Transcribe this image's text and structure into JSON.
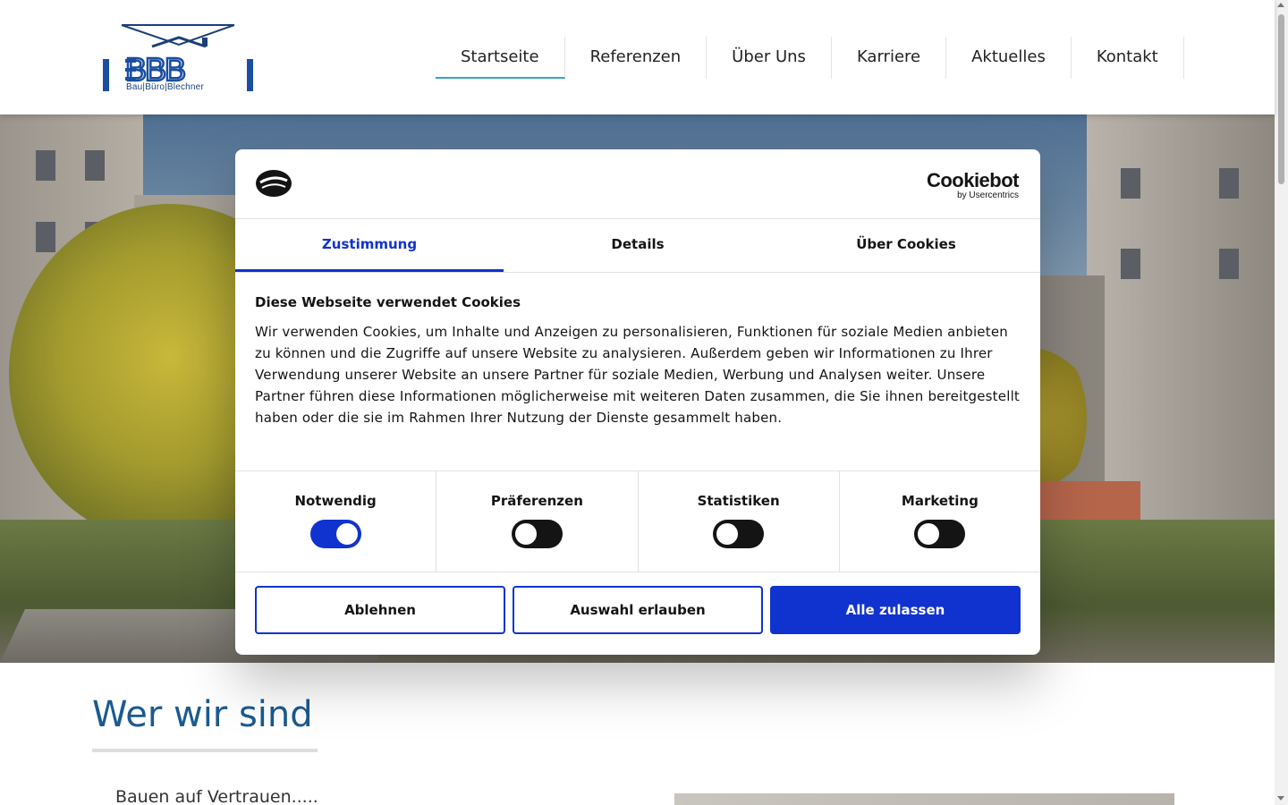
{
  "header": {
    "logo_text": "BBB",
    "logo_sub": "Bau|Büro|Blechner",
    "nav": [
      {
        "label": "Startseite",
        "active": true
      },
      {
        "label": "Referenzen"
      },
      {
        "label": "Über Uns"
      },
      {
        "label": "Karriere"
      },
      {
        "label": "Aktuelles"
      },
      {
        "label": "Kontakt"
      }
    ]
  },
  "main": {
    "section_title": "Wer wir sind",
    "intro": "Bauen auf Vertrauen....."
  },
  "cookie_dialog": {
    "brand": "Cookiebot",
    "brand_sub": "by Usercentrics",
    "tabs": [
      {
        "label": "Zustimmung",
        "active": true
      },
      {
        "label": "Details"
      },
      {
        "label": "Über Cookies"
      }
    ],
    "title": "Diese Webseite verwendet Cookies",
    "text": "Wir verwenden Cookies, um Inhalte und Anzeigen zu personalisieren, Funktionen für soziale Medien anbieten zu können und die Zugriffe auf unsere Website zu analysieren. Außerdem geben wir Informationen zu Ihrer Verwendung unserer Website an unsere Partner für soziale Medien, Werbung und Analysen weiter. Unsere Partner führen diese Informationen möglicherweise mit weiteren Daten zusammen, die Sie ihnen bereitgestellt haben oder die sie im Rahmen Ihrer Nutzung der Dienste gesammelt haben.",
    "toggles": [
      {
        "label": "Notwendig",
        "on": true
      },
      {
        "label": "Präferenzen",
        "on": false
      },
      {
        "label": "Statistiken",
        "on": false
      },
      {
        "label": "Marketing",
        "on": false
      }
    ],
    "buttons": {
      "decline": "Ablehnen",
      "allow_selection": "Auswahl erlauben",
      "allow_all": "Alle zulassen"
    }
  },
  "colors": {
    "accent": "#1032cf",
    "title_blue": "#1a5a90",
    "logo_blue": "#1a3f7a"
  }
}
